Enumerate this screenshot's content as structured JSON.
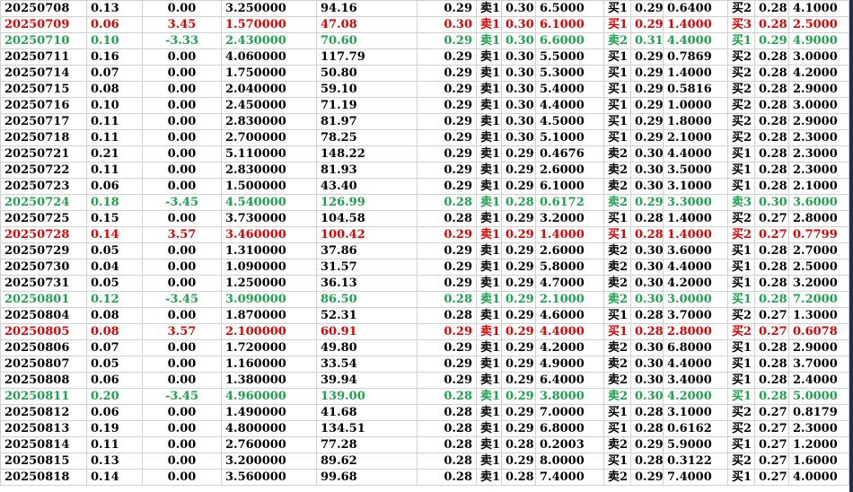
{
  "rows": [
    {
      "date": "20250708",
      "c1": "0.13",
      "c2": "0.00",
      "c3": "3.250000",
      "c4": "94.16",
      "c5": "0.29",
      "s1": "卖1",
      "p1": "0.30",
      "v1": "6.5000",
      "s2": "买1",
      "p2": "0.29",
      "v2": "0.6400",
      "s3": "买2",
      "p3": "0.28",
      "v3": "4.1000",
      "color": "black"
    },
    {
      "date": "20250709",
      "c1": "0.06",
      "c2": "3.45",
      "c3": "1.570000",
      "c4": "47.08",
      "c5": "0.30",
      "s1": "卖1",
      "p1": "0.30",
      "v1": "6.1000",
      "s2": "买1",
      "p2": "0.29",
      "v2": "1.4000",
      "s3": "买3",
      "p3": "0.28",
      "v3": "2.5000",
      "color": "red"
    },
    {
      "date": "20250710",
      "c1": "0.10",
      "c2": "-3.33",
      "c3": "2.430000",
      "c4": "70.60",
      "c5": "0.29",
      "s1": "卖1",
      "p1": "0.30",
      "v1": "6.6000",
      "s2": "卖2",
      "p2": "0.31",
      "v2": "4.4000",
      "s3": "买1",
      "p3": "0.29",
      "v3": "4.9000",
      "color": "green"
    },
    {
      "date": "20250711",
      "c1": "0.16",
      "c2": "0.00",
      "c3": "4.060000",
      "c4": "117.79",
      "c5": "0.29",
      "s1": "卖1",
      "p1": "0.30",
      "v1": "5.5000",
      "s2": "买1",
      "p2": "0.29",
      "v2": "0.7869",
      "s3": "买2",
      "p3": "0.28",
      "v3": "3.0000",
      "color": "black"
    },
    {
      "date": "20250714",
      "c1": "0.07",
      "c2": "0.00",
      "c3": "1.750000",
      "c4": "50.80",
      "c5": "0.29",
      "s1": "卖1",
      "p1": "0.30",
      "v1": "5.3000",
      "s2": "买1",
      "p2": "0.29",
      "v2": "1.4000",
      "s3": "买2",
      "p3": "0.28",
      "v3": "4.2000",
      "color": "black"
    },
    {
      "date": "20250715",
      "c1": "0.08",
      "c2": "0.00",
      "c3": "2.040000",
      "c4": "59.10",
      "c5": "0.29",
      "s1": "卖1",
      "p1": "0.30",
      "v1": "5.4000",
      "s2": "买1",
      "p2": "0.29",
      "v2": "0.5816",
      "s3": "买2",
      "p3": "0.28",
      "v3": "2.9000",
      "color": "black"
    },
    {
      "date": "20250716",
      "c1": "0.10",
      "c2": "0.00",
      "c3": "2.450000",
      "c4": "71.19",
      "c5": "0.29",
      "s1": "卖1",
      "p1": "0.30",
      "v1": "4.4000",
      "s2": "买1",
      "p2": "0.29",
      "v2": "1.0000",
      "s3": "买2",
      "p3": "0.28",
      "v3": "3.0000",
      "color": "black"
    },
    {
      "date": "20250717",
      "c1": "0.11",
      "c2": "0.00",
      "c3": "2.830000",
      "c4": "81.97",
      "c5": "0.29",
      "s1": "卖1",
      "p1": "0.30",
      "v1": "4.5000",
      "s2": "买1",
      "p2": "0.29",
      "v2": "1.8000",
      "s3": "买2",
      "p3": "0.28",
      "v3": "2.9000",
      "color": "black"
    },
    {
      "date": "20250718",
      "c1": "0.11",
      "c2": "0.00",
      "c3": "2.700000",
      "c4": "78.25",
      "c5": "0.29",
      "s1": "卖1",
      "p1": "0.30",
      "v1": "5.1000",
      "s2": "买1",
      "p2": "0.29",
      "v2": "2.1000",
      "s3": "买2",
      "p3": "0.28",
      "v3": "2.3000",
      "color": "black"
    },
    {
      "date": "20250721",
      "c1": "0.21",
      "c2": "0.00",
      "c3": "5.110000",
      "c4": "148.22",
      "c5": "0.29",
      "s1": "卖1",
      "p1": "0.29",
      "v1": "0.4676",
      "s2": "卖2",
      "p2": "0.30",
      "v2": "4.4000",
      "s3": "买1",
      "p3": "0.28",
      "v3": "2.3000",
      "color": "black"
    },
    {
      "date": "20250722",
      "c1": "0.11",
      "c2": "0.00",
      "c3": "2.830000",
      "c4": "81.93",
      "c5": "0.29",
      "s1": "卖1",
      "p1": "0.29",
      "v1": "2.6000",
      "s2": "卖2",
      "p2": "0.30",
      "v2": "3.5000",
      "s3": "买1",
      "p3": "0.28",
      "v3": "2.3000",
      "color": "black"
    },
    {
      "date": "20250723",
      "c1": "0.06",
      "c2": "0.00",
      "c3": "1.500000",
      "c4": "43.40",
      "c5": "0.29",
      "s1": "卖1",
      "p1": "0.29",
      "v1": "6.1000",
      "s2": "卖2",
      "p2": "0.30",
      "v2": "3.1000",
      "s3": "买1",
      "p3": "0.28",
      "v3": "2.1000",
      "color": "black"
    },
    {
      "date": "20250724",
      "c1": "0.18",
      "c2": "-3.45",
      "c3": "4.540000",
      "c4": "126.99",
      "c5": "0.28",
      "s1": "卖1",
      "p1": "0.28",
      "v1": "0.6172",
      "s2": "卖2",
      "p2": "0.29",
      "v2": "3.3000",
      "s3": "卖3",
      "p3": "0.30",
      "v3": "3.6000",
      "color": "green"
    },
    {
      "date": "20250725",
      "c1": "0.15",
      "c2": "0.00",
      "c3": "3.730000",
      "c4": "104.58",
      "c5": "0.28",
      "s1": "卖1",
      "p1": "0.29",
      "v1": "3.2000",
      "s2": "买1",
      "p2": "0.28",
      "v2": "1.4000",
      "s3": "买2",
      "p3": "0.27",
      "v3": "2.8000",
      "color": "black"
    },
    {
      "date": "20250728",
      "c1": "0.14",
      "c2": "3.57",
      "c3": "3.460000",
      "c4": "100.42",
      "c5": "0.29",
      "s1": "卖1",
      "p1": "0.29",
      "v1": "1.4000",
      "s2": "买1",
      "p2": "0.28",
      "v2": "1.4000",
      "s3": "买2",
      "p3": "0.27",
      "v3": "0.7799",
      "color": "red"
    },
    {
      "date": "20250729",
      "c1": "0.05",
      "c2": "0.00",
      "c3": "1.310000",
      "c4": "37.86",
      "c5": "0.29",
      "s1": "卖1",
      "p1": "0.29",
      "v1": "2.6000",
      "s2": "卖2",
      "p2": "0.30",
      "v2": "3.6000",
      "s3": "买1",
      "p3": "0.28",
      "v3": "2.7000",
      "color": "black"
    },
    {
      "date": "20250730",
      "c1": "0.04",
      "c2": "0.00",
      "c3": "1.090000",
      "c4": "31.57",
      "c5": "0.29",
      "s1": "卖1",
      "p1": "0.29",
      "v1": "5.8000",
      "s2": "卖2",
      "p2": "0.30",
      "v2": "4.4000",
      "s3": "买1",
      "p3": "0.28",
      "v3": "2.5000",
      "color": "black"
    },
    {
      "date": "20250731",
      "c1": "0.05",
      "c2": "0.00",
      "c3": "1.250000",
      "c4": "36.13",
      "c5": "0.29",
      "s1": "卖1",
      "p1": "0.29",
      "v1": "4.7000",
      "s2": "卖2",
      "p2": "0.30",
      "v2": "4.2000",
      "s3": "买1",
      "p3": "0.28",
      "v3": "3.2000",
      "color": "black"
    },
    {
      "date": "20250801",
      "c1": "0.12",
      "c2": "-3.45",
      "c3": "3.090000",
      "c4": "86.50",
      "c5": "0.28",
      "s1": "卖1",
      "p1": "0.29",
      "v1": "2.1000",
      "s2": "卖2",
      "p2": "0.30",
      "v2": "3.0000",
      "s3": "买1",
      "p3": "0.28",
      "v3": "7.2000",
      "color": "green"
    },
    {
      "date": "20250804",
      "c1": "0.08",
      "c2": "0.00",
      "c3": "1.870000",
      "c4": "52.31",
      "c5": "0.28",
      "s1": "卖1",
      "p1": "0.29",
      "v1": "4.6000",
      "s2": "买1",
      "p2": "0.28",
      "v2": "3.7000",
      "s3": "买2",
      "p3": "0.27",
      "v3": "1.3000",
      "color": "black"
    },
    {
      "date": "20250805",
      "c1": "0.08",
      "c2": "3.57",
      "c3": "2.100000",
      "c4": "60.91",
      "c5": "0.29",
      "s1": "卖1",
      "p1": "0.29",
      "v1": "4.4000",
      "s2": "买1",
      "p2": "0.28",
      "v2": "2.8000",
      "s3": "买2",
      "p3": "0.27",
      "v3": "0.6078",
      "color": "red"
    },
    {
      "date": "20250806",
      "c1": "0.07",
      "c2": "0.00",
      "c3": "1.720000",
      "c4": "49.80",
      "c5": "0.29",
      "s1": "卖1",
      "p1": "0.29",
      "v1": "4.2000",
      "s2": "卖2",
      "p2": "0.30",
      "v2": "6.8000",
      "s3": "买1",
      "p3": "0.28",
      "v3": "2.9000",
      "color": "black"
    },
    {
      "date": "20250807",
      "c1": "0.05",
      "c2": "0.00",
      "c3": "1.160000",
      "c4": "33.54",
      "c5": "0.29",
      "s1": "卖1",
      "p1": "0.29",
      "v1": "4.9000",
      "s2": "卖2",
      "p2": "0.30",
      "v2": "4.4000",
      "s3": "买1",
      "p3": "0.28",
      "v3": "3.7000",
      "color": "black"
    },
    {
      "date": "20250808",
      "c1": "0.06",
      "c2": "0.00",
      "c3": "1.380000",
      "c4": "39.94",
      "c5": "0.29",
      "s1": "卖1",
      "p1": "0.29",
      "v1": "6.4000",
      "s2": "卖2",
      "p2": "0.30",
      "v2": "3.4000",
      "s3": "买1",
      "p3": "0.28",
      "v3": "2.4000",
      "color": "black"
    },
    {
      "date": "20250811",
      "c1": "0.20",
      "c2": "-3.45",
      "c3": "4.960000",
      "c4": "139.00",
      "c5": "0.28",
      "s1": "卖1",
      "p1": "0.29",
      "v1": "3.8000",
      "s2": "卖2",
      "p2": "0.30",
      "v2": "4.2000",
      "s3": "买1",
      "p3": "0.28",
      "v3": "5.0000",
      "color": "green"
    },
    {
      "date": "20250812",
      "c1": "0.06",
      "c2": "0.00",
      "c3": "1.490000",
      "c4": "41.68",
      "c5": "0.28",
      "s1": "卖1",
      "p1": "0.29",
      "v1": "7.0000",
      "s2": "买1",
      "p2": "0.28",
      "v2": "3.1000",
      "s3": "买2",
      "p3": "0.27",
      "v3": "0.8179",
      "color": "black"
    },
    {
      "date": "20250813",
      "c1": "0.19",
      "c2": "0.00",
      "c3": "4.800000",
      "c4": "134.51",
      "c5": "0.28",
      "s1": "卖1",
      "p1": "0.29",
      "v1": "6.8000",
      "s2": "买1",
      "p2": "0.28",
      "v2": "0.6162",
      "s3": "买2",
      "p3": "0.27",
      "v3": "2.3000",
      "color": "black"
    },
    {
      "date": "20250814",
      "c1": "0.11",
      "c2": "0.00",
      "c3": "2.760000",
      "c4": "77.28",
      "c5": "0.28",
      "s1": "卖1",
      "p1": "0.28",
      "v1": "0.2003",
      "s2": "卖2",
      "p2": "0.29",
      "v2": "5.9000",
      "s3": "买1",
      "p3": "0.27",
      "v3": "1.2000",
      "color": "black"
    },
    {
      "date": "20250815",
      "c1": "0.13",
      "c2": "0.00",
      "c3": "3.200000",
      "c4": "89.62",
      "c5": "0.28",
      "s1": "卖1",
      "p1": "0.29",
      "v1": "8.0000",
      "s2": "买1",
      "p2": "0.28",
      "v2": "0.3122",
      "s3": "买2",
      "p3": "0.27",
      "v3": "1.6000",
      "color": "black"
    },
    {
      "date": "20250818",
      "c1": "0.14",
      "c2": "0.00",
      "c3": "3.560000",
      "c4": "99.68",
      "c5": "0.28",
      "s1": "卖1",
      "p1": "0.28",
      "v1": "7.4000",
      "s2": "卖2",
      "p2": "0.29",
      "v2": "7.4000",
      "s3": "买1",
      "p3": "0.27",
      "v3": "4.0000",
      "color": "black"
    }
  ],
  "colors": {
    "red": "#e00000",
    "green": "#1aa34a",
    "black": "#000000",
    "grid": "#d0d0d0"
  }
}
